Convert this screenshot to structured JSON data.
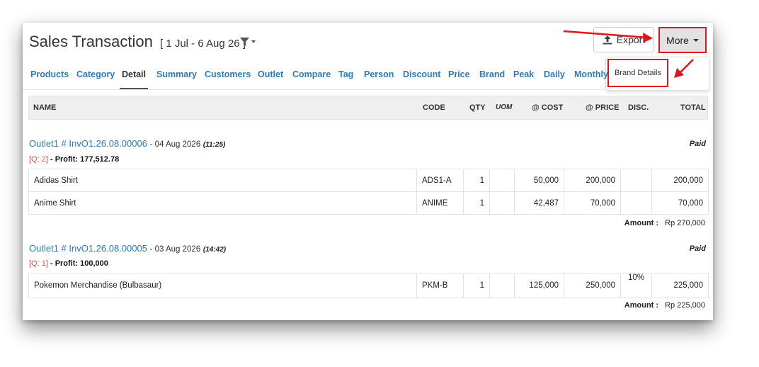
{
  "header": {
    "title": "Sales Transaction",
    "range": "[ 1 Jul - 6 Aug 26 ]",
    "export_label": "Export",
    "more_label": "More",
    "dropdown": {
      "brand_details": "Brand Details"
    }
  },
  "tabs": [
    {
      "label": "Products"
    },
    {
      "label": "Category"
    },
    {
      "label": "Detail"
    },
    {
      "label": "Summary"
    },
    {
      "label": "Customers"
    },
    {
      "label": "Outlet"
    },
    {
      "label": "Compare"
    },
    {
      "label": "Tag"
    },
    {
      "label": "Person"
    },
    {
      "label": "Discount"
    },
    {
      "label": "Price"
    },
    {
      "label": "Brand"
    },
    {
      "label": "Peak"
    },
    {
      "label": "Daily"
    },
    {
      "label": "Monthly"
    }
  ],
  "active_tab": "Detail",
  "columns": {
    "name": "NAME",
    "code": "CODE",
    "qty": "QTY",
    "uom": "UOM",
    "cost": "@ COST",
    "price": "@ PRICE",
    "disc": "DISC.",
    "total": "TOTAL"
  },
  "invoices": [
    {
      "outlet_invoice": "Outlet1 # InvO1.26.08.00006",
      "date": "- 04 Aug 2026",
      "time": "(11:25)",
      "status": "Paid",
      "q": "[Q: 2]",
      "profit": "- Profit: 177,512.78",
      "items": [
        {
          "name": "Adidas Shirt",
          "code": "ADS1-A",
          "qty": "1",
          "uom": "",
          "cost": "50,000",
          "price": "200,000",
          "disc": "",
          "total": "200,000"
        },
        {
          "name": "Anime Shirt",
          "code": "ANIME",
          "qty": "1",
          "uom": "",
          "cost": "42,487",
          "price": "70,000",
          "disc": "",
          "total": "70,000"
        }
      ],
      "amount_label": "Amount :",
      "amount_value": "Rp  270,000"
    },
    {
      "outlet_invoice": "Outlet1 # InvO1.26.08.00005",
      "date": "- 03 Aug 2026",
      "time": "(14:42)",
      "status": "Paid",
      "q": "[Q: 1]",
      "profit": "- Profit: 100,000",
      "items": [
        {
          "name": "Pokemon Merchandise (Bulbasaur)",
          "code": "PKM-B",
          "qty": "1",
          "uom": "",
          "cost": "125,000",
          "price": "250,000",
          "disc": "10%",
          "total": "225,000"
        }
      ],
      "amount_label": "Amount :",
      "amount_value": "Rp  225,000"
    }
  ],
  "icons": {
    "filter": "filter-dropdown-icon",
    "export": "upload-icon",
    "more": "caret-down-icon"
  },
  "colors": {
    "link": "#2f7ab5",
    "annotation": "#e3131b",
    "discount": "#e05a5a"
  }
}
